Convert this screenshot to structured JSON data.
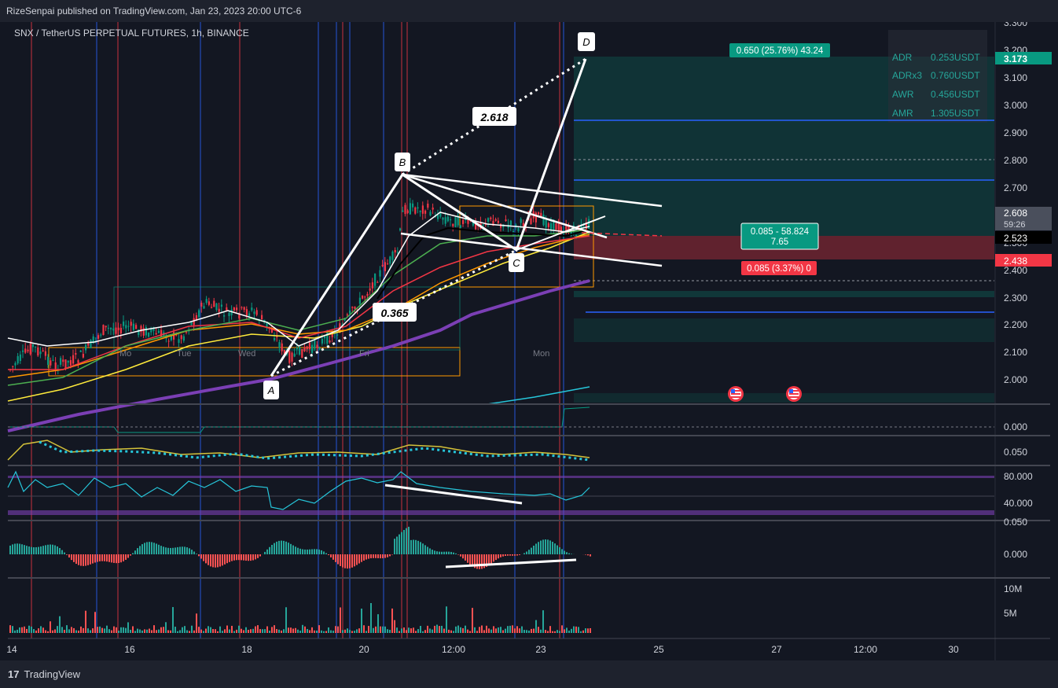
{
  "header": {
    "published": "RizeSenpai published on TradingView.com, Jan 23, 2023 20:00 UTC-6",
    "symbol": "SNX / TetherUS PERPETUAL FUTURES, 1h, BINANCE"
  },
  "footer": {
    "brand": "TradingView",
    "brand_logo": "17"
  },
  "stats": [
    {
      "label": "ADR",
      "value": "0.253USDT"
    },
    {
      "label": "ADRx3",
      "value": "0.760USDT"
    },
    {
      "label": "AWR",
      "value": "0.456USDT"
    },
    {
      "label": "AMR",
      "value": "1.305USDT"
    }
  ],
  "price_axis": {
    "ticks": [
      "3.300",
      "3.200",
      "3.100",
      "3.000",
      "2.900",
      "2.800",
      "2.700",
      "2.608",
      "2.500",
      "2.400",
      "2.300",
      "2.200",
      "2.100",
      "2.000"
    ],
    "tags": [
      {
        "text": "3.173",
        "color": "#089981"
      },
      {
        "text": "2.608",
        "color": "#4a4f5c"
      },
      {
        "text": "59:26",
        "color": "#4a4f5c"
      },
      {
        "text": "2.523",
        "color": "#000000"
      },
      {
        "text": "2.438",
        "color": "#f23645"
      }
    ]
  },
  "pattern": {
    "points": [
      "A",
      "B",
      "C",
      "D"
    ],
    "ratios": [
      "0.365",
      "2.618"
    ]
  },
  "positions": {
    "target": "0.650 (25.76%) 43.24",
    "ratio_line1": "0.085 - 58.824",
    "ratio_line2": "7.65",
    "stop": "0.085 (3.37%) 0"
  },
  "day_labels": [
    "Mo",
    "Tue",
    "Wed",
    "Fri",
    "Mon"
  ],
  "panes": {
    "p1": [
      "0.000"
    ],
    "p2": [
      "0.050"
    ],
    "rsi": [
      "80.000",
      "40.000"
    ],
    "macd": [
      "0.050",
      "0.000"
    ],
    "volume": [
      "10M",
      "5M"
    ]
  },
  "time_axis": [
    "14",
    "16",
    "18",
    "20",
    "12:00",
    "23",
    "25",
    "27",
    "12:00",
    "30"
  ],
  "colors": {
    "bg": "#131722",
    "green": "#089981",
    "red": "#f23645",
    "purple": "#7b3fb5",
    "cyan": "#26c6da",
    "orange": "#ff9800",
    "yellow": "#ffeb3b"
  },
  "chart_data": {
    "type": "candlestick",
    "title": "SNX / TetherUS PERPETUAL FUTURES, 1h, BINANCE",
    "ylim": [
      1.95,
      3.3
    ],
    "x_ticks": [
      "14",
      "16",
      "18",
      "20",
      "12:00",
      "23",
      "25",
      "27",
      "12:00",
      "30"
    ],
    "harmonic_points": [
      {
        "label": "A",
        "price": 2.02
      },
      {
        "label": "B",
        "price": 2.75
      },
      {
        "label": "C",
        "price": 2.47
      },
      {
        "label": "D",
        "price": 3.17
      }
    ],
    "fib_ratios": [
      0.365,
      2.618
    ],
    "last_price": 2.608,
    "entry": 2.523,
    "stop": 2.438,
    "target": 3.173
  }
}
